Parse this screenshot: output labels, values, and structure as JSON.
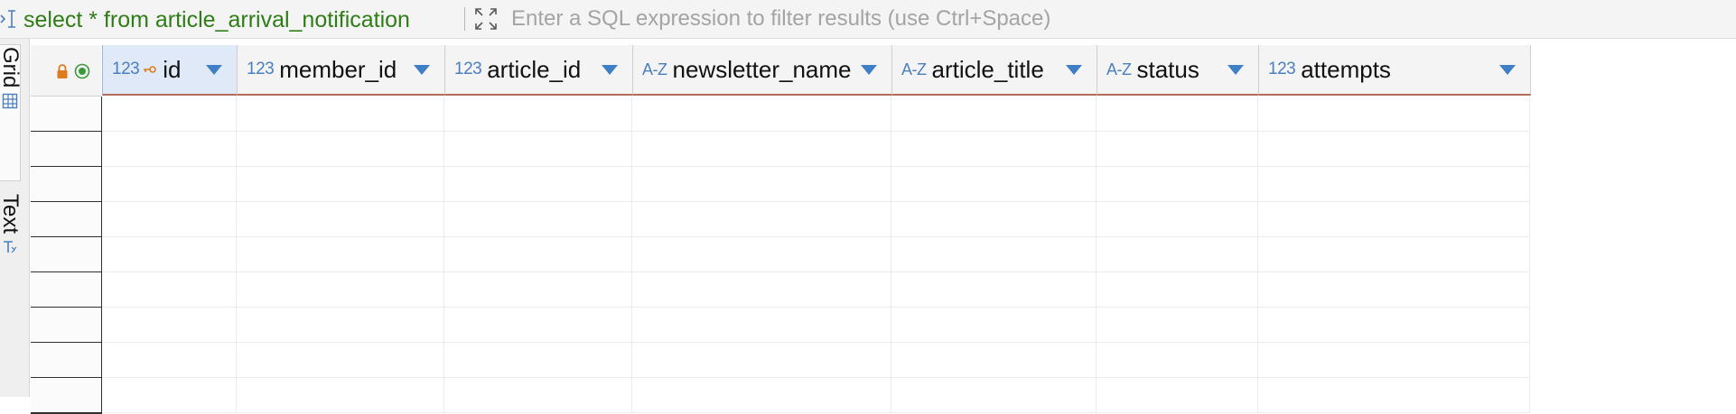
{
  "filter_bar": {
    "query_text": "select * from article_arrival_notification",
    "filter_placeholder": "Enter a SQL expression to filter results (use Ctrl+Space)",
    "filter_value": ""
  },
  "side_tabs": [
    {
      "label": "Grid",
      "icon": "grid-icon",
      "active": true
    },
    {
      "label": "Text",
      "icon": "text-icon",
      "active": false
    }
  ],
  "columns": [
    {
      "type_icon": "123",
      "name": "id",
      "primary_key": true,
      "selected": true
    },
    {
      "type_icon": "123",
      "name": "member_id",
      "primary_key": false,
      "selected": false
    },
    {
      "type_icon": "123",
      "name": "article_id",
      "primary_key": false,
      "selected": false
    },
    {
      "type_icon": "A-Z",
      "name": "newsletter_name",
      "primary_key": false,
      "selected": false
    },
    {
      "type_icon": "A-Z",
      "name": "article_title",
      "primary_key": false,
      "selected": false
    },
    {
      "type_icon": "A-Z",
      "name": "status",
      "primary_key": false,
      "selected": false
    },
    {
      "type_icon": "123",
      "name": "attempts",
      "primary_key": false,
      "selected": false
    }
  ],
  "rows": [
    [],
    [],
    [],
    [],
    [],
    [],
    [],
    [],
    []
  ],
  "colors": {
    "query_green": "#2e7d16",
    "type_icon_blue": "#4a7fbf",
    "sort_arrow_blue": "#3f7fc6",
    "header_underline": "#b56b5a",
    "selected_header_bg": "#dfe9f8",
    "lock_orange": "#e07b1d",
    "radio_green": "#3a9a3a"
  }
}
